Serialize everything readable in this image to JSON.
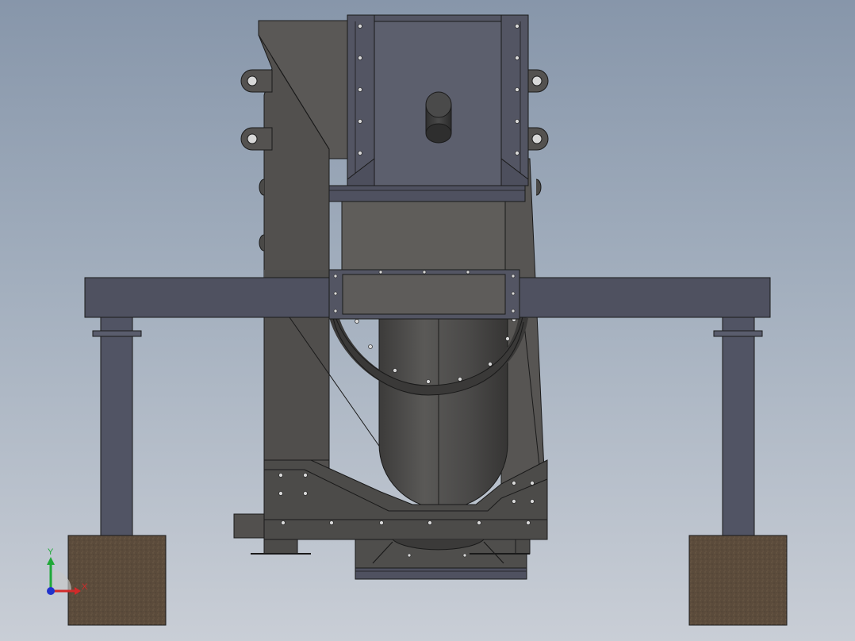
{
  "viewport": {
    "background_top": "#8796aa",
    "background_bottom": "#c9ced6"
  },
  "colors": {
    "body_dark": "#4f4e4c",
    "body_mid": "#5e5c5a",
    "hopper_face": "#5c5f6d",
    "hopper_frame": "#535563",
    "frame_beam": "#4f5160",
    "leg": "#515464",
    "foundation": "#5b4b3b",
    "edge": "#1a1a1a",
    "hole": "#d8d8d8"
  },
  "triad": {
    "y_label": "Y",
    "x_label": "X",
    "y_color": "#1fa838",
    "x_color": "#d22a2a",
    "z_color": "#2233cc"
  }
}
